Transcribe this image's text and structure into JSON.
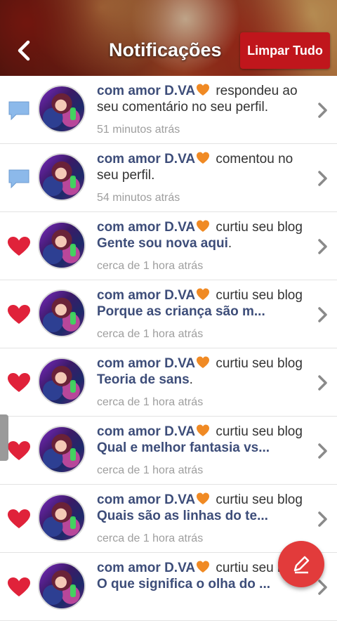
{
  "header": {
    "title": "Notificações",
    "clear_label": "Limpar Tudo",
    "back_icon": "chevron-left-icon"
  },
  "colors": {
    "accent_red": "#c0161c",
    "username_blue": "#3d4d79",
    "heart_red": "#e0223a",
    "comment_blue": "#8cb9ea",
    "emoji_orange": "#f08a24",
    "fab_red": "#e23b3b"
  },
  "notifications": [
    {
      "type": "comment",
      "icon": "speech-bubble-icon",
      "user": "com amor D.VA",
      "action": " respondeu ao seu comentário no seu perfil.",
      "target": "",
      "suffix": "",
      "time": "51 minutos atrás"
    },
    {
      "type": "comment",
      "icon": "speech-bubble-icon",
      "user": "com amor D.VA",
      "action": " comentou no seu perfil.",
      "target": "",
      "suffix": "",
      "time": "54 minutos atrás"
    },
    {
      "type": "like",
      "icon": "heart-icon",
      "user": "com amor D.VA",
      "action": " curtiu seu blog ",
      "target": "Gente sou nova aqui",
      "suffix": ".",
      "time": "cerca de 1 hora atrás"
    },
    {
      "type": "like",
      "icon": "heart-icon",
      "user": "com amor D.VA",
      "action": " curtiu seu blog ",
      "target": "Porque as criança são m...",
      "suffix": "",
      "time": "cerca de 1 hora atrás"
    },
    {
      "type": "like",
      "icon": "heart-icon",
      "user": "com amor D.VA",
      "action": " curtiu seu blog ",
      "target": "Teoria de sans",
      "suffix": ".",
      "time": "cerca de 1 hora atrás"
    },
    {
      "type": "like",
      "icon": "heart-icon",
      "user": "com amor D.VA",
      "action": " curtiu seu blog ",
      "target": "Qual e melhor fantasia vs...",
      "suffix": "",
      "time": "cerca de 1 hora atrás"
    },
    {
      "type": "like",
      "icon": "heart-icon",
      "user": "com amor D.VA",
      "action": " curtiu seu blog ",
      "target": "Quais são as linhas do te...",
      "suffix": "",
      "time": "cerca de 1 hora atrás"
    },
    {
      "type": "like",
      "icon": "heart-icon",
      "user": "com amor D.VA",
      "action": " curtiu seu blog ",
      "target": "O que significa o olha do ...",
      "suffix": "",
      "time": ""
    }
  ],
  "fab": {
    "icon": "pencil-icon"
  }
}
